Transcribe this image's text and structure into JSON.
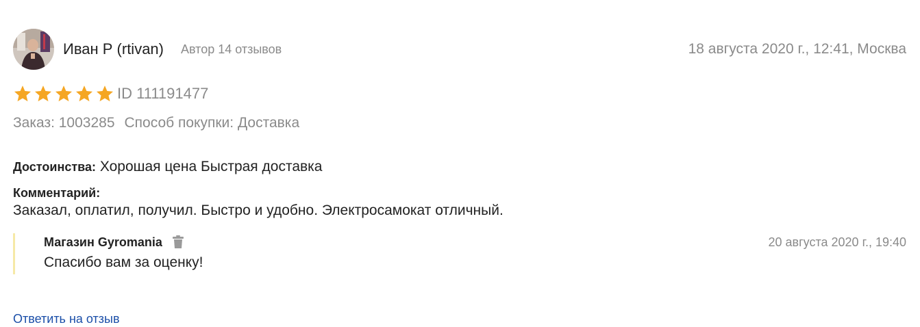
{
  "review": {
    "author_name": "Иван Р (rtivan)",
    "author_meta": "Автор 14 отзывов",
    "date": "18 августа 2020 г., 12:41, Москва",
    "rating": 5,
    "rating_max": 5,
    "id_label": "ID 111191477",
    "order": "Заказ: 1003285",
    "purchase_method": "Способ покупки: Доставка",
    "pros_label": "Достоинства:",
    "pros_text": "Хорошая цена Быстрая доставка",
    "comment_label": "Комментарий:",
    "comment_text": "Заказал, оплатил, получил. Быстро и удобно. Электросамокат отличный."
  },
  "reply": {
    "author": "Магазин Gyromania",
    "date": "20 августа 2020 г., 19:40",
    "text": "Спасибо вам за оценку!"
  },
  "actions": {
    "answer_link": "Ответить на отзыв"
  },
  "colors": {
    "star": "#f5a623",
    "muted_text": "#8a8a8a",
    "link": "#1a4ea8",
    "reply_bar": "#f6e9a6"
  },
  "icons": {
    "star": "star-icon",
    "trash": "trash-icon",
    "avatar": "avatar"
  }
}
